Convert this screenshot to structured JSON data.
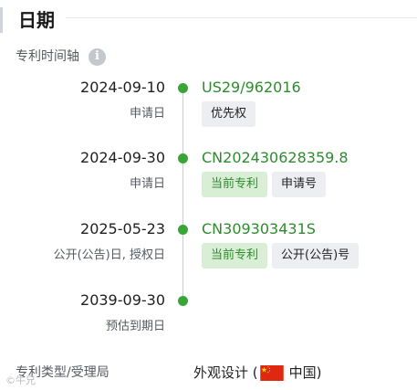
{
  "section": {
    "title": "日期"
  },
  "timeline": {
    "label": "专利时间轴",
    "info_icon_glyph": "i",
    "accent_color": "#3aa537",
    "events": [
      {
        "date": "2024-09-10",
        "sublabel": "申请日",
        "doc_number": "US29/962016",
        "tags": [
          "优先权"
        ]
      },
      {
        "date": "2024-09-30",
        "sublabel": "申请日",
        "doc_number": "CN202430628359.8",
        "tags": [
          "当前专利",
          "申请号"
        ]
      },
      {
        "date": "2025-05-23",
        "sublabel": "公开(公告)日, 授权日",
        "doc_number": "CN309303431S",
        "tags": [
          "当前专利",
          "公开(公告)号"
        ]
      },
      {
        "date": "2039-09-30",
        "sublabel": "预估到期日",
        "doc_number": "",
        "tags": []
      }
    ]
  },
  "footer": {
    "label": "专利类型/受理局",
    "value_prefix": "外观设计 (",
    "flag_icon": "china-flag-icon",
    "value_country": "中国)"
  },
  "watermark": {
    "text": "©牛兄"
  }
}
